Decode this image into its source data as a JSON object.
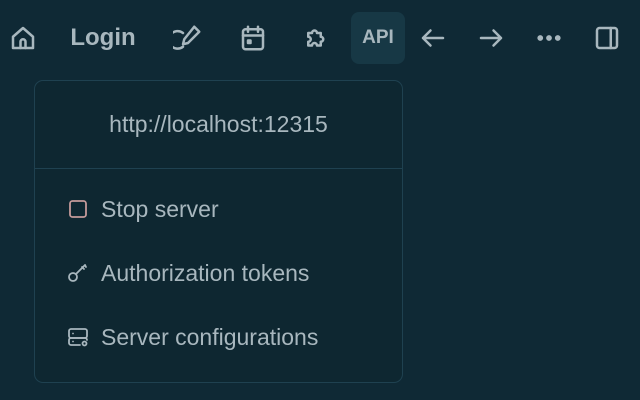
{
  "toolbar": {
    "login_label": "Login",
    "api_label": "API",
    "icons": [
      "home-icon",
      "pencil-icon",
      "calendar-icon",
      "puzzle-icon",
      "arrow-left-icon",
      "arrow-right-icon",
      "more-icon",
      "sidebar-panel-icon"
    ]
  },
  "menu": {
    "url": "http://localhost:12315",
    "items": [
      {
        "label": "Stop server",
        "icon": "stop-icon"
      },
      {
        "label": "Authorization tokens",
        "icon": "key-icon"
      },
      {
        "label": "Server configurations",
        "icon": "server-cog-icon"
      }
    ]
  },
  "colors": {
    "background": "#0f2935",
    "text": "#a8b7be",
    "stop_icon": "#c49a9a",
    "active_button": "#173845"
  }
}
